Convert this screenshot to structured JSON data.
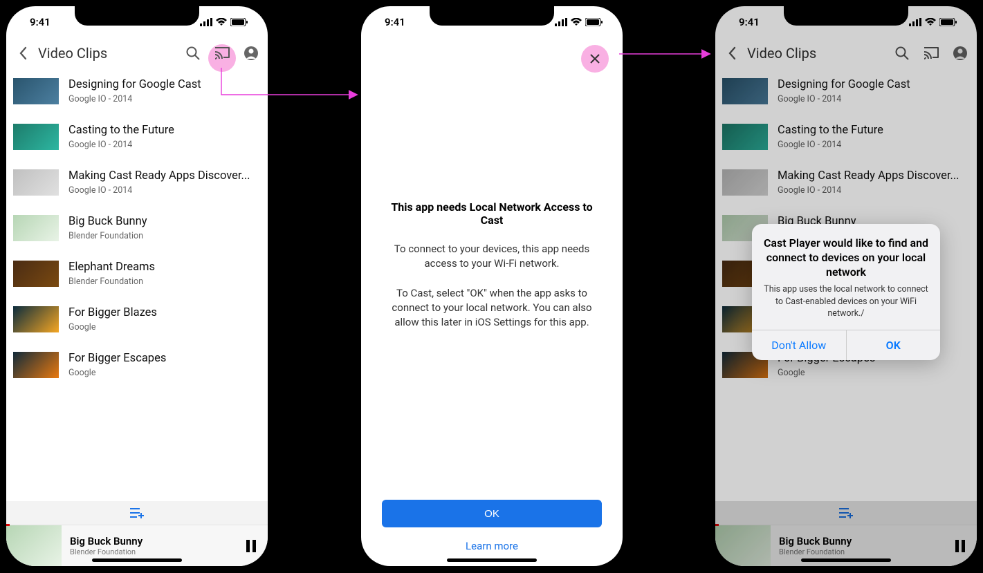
{
  "status": {
    "time": "9:41"
  },
  "nav": {
    "title": "Video Clips"
  },
  "videos": [
    {
      "title": "Designing for Google Cast",
      "sub": "Google IO - 2014"
    },
    {
      "title": "Casting to the Future",
      "sub": "Google IO - 2014"
    },
    {
      "title": "Making Cast Ready Apps Discover...",
      "sub": "Google IO - 2014"
    },
    {
      "title": "Big Buck Bunny",
      "sub": "Blender Foundation"
    },
    {
      "title": "Elephant Dreams",
      "sub": "Blender Foundation"
    },
    {
      "title": "For Bigger Blazes",
      "sub": "Google"
    },
    {
      "title": "For Bigger Escapes",
      "sub": "Google"
    }
  ],
  "now_playing": {
    "title": "Big Buck Bunny",
    "sub": "Blender Foundation"
  },
  "interstitial": {
    "title": "This app needs Local Network Access to Cast",
    "p1": "To connect to your devices, this app needs access to your Wi-Fi network.",
    "p2": "To Cast, select \"OK\" when the app asks to connect to your local network. You can also allow this later in iOS Settings for this app.",
    "ok": "OK",
    "learn": "Learn more"
  },
  "alert": {
    "title": "Cast Player would like to find and connect to devices on your local network",
    "msg": "This app uses the local network to connect to Cast-enabled devices on your WiFi network./",
    "deny": "Don't Allow",
    "ok": "OK"
  }
}
